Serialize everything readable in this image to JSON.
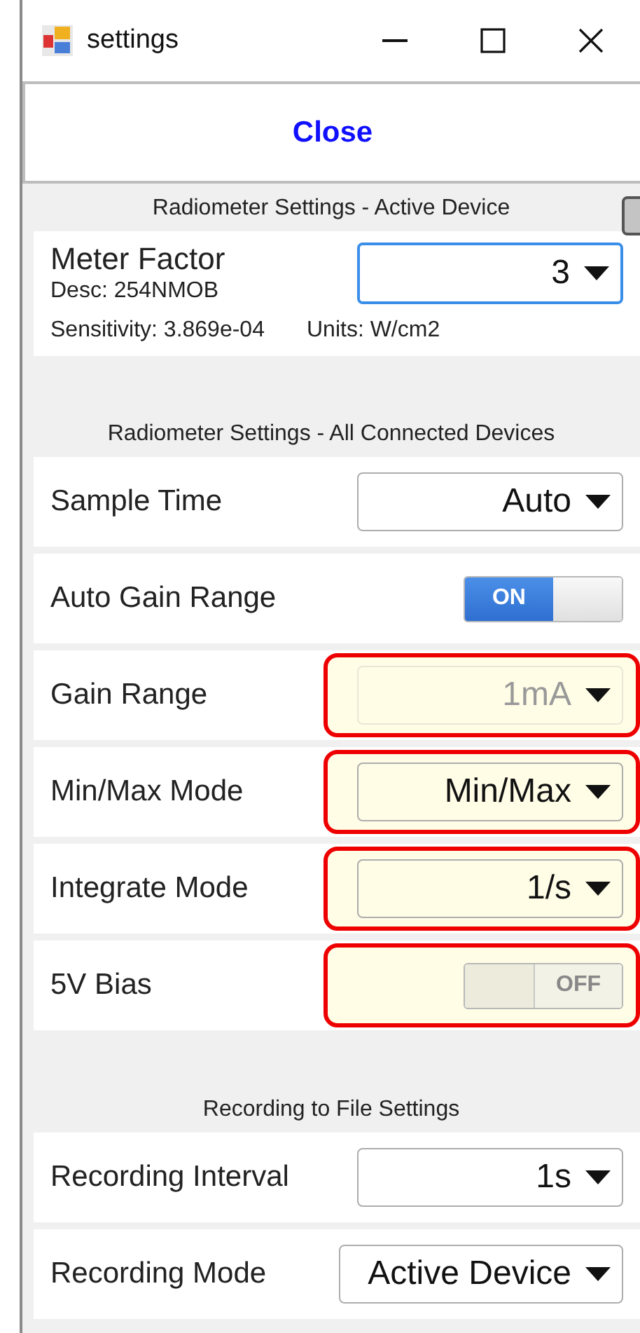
{
  "window": {
    "title": "settings"
  },
  "close_button": {
    "label": "Close"
  },
  "active_device": {
    "header": "Radiometer Settings - Active Device",
    "label": "Meter Factor",
    "desc": "Desc:  254NMOB",
    "sensitivity": "Sensitivity:  3.869e-04",
    "units": "Units: W/cm2",
    "dropdown": {
      "value": "3",
      "focused": true
    }
  },
  "sections": [
    {
      "header": "Radiometer Settings - All Connected Devices",
      "rows": [
        {
          "kind": "dropdown",
          "label": "Sample Time",
          "value": "Auto",
          "disabled": false,
          "highlighted": false
        },
        {
          "kind": "toggle",
          "label": "Auto Gain Range",
          "on": true,
          "toggle_label": "ON",
          "disabled": false,
          "highlighted": false
        },
        {
          "kind": "dropdown",
          "label": "Gain Range",
          "value": "1mA",
          "disabled": true,
          "highlighted": true
        },
        {
          "kind": "dropdown",
          "label": "Min/Max Mode",
          "value": "Min/Max",
          "disabled": false,
          "highlighted": true
        },
        {
          "kind": "dropdown",
          "label": "Integrate Mode",
          "value": "1/s",
          "disabled": false,
          "highlighted": true
        },
        {
          "kind": "toggle",
          "label": "5V Bias",
          "on": false,
          "toggle_label": "OFF",
          "disabled": true,
          "highlighted": true
        }
      ]
    },
    {
      "header": "Recording to File Settings",
      "rows": [
        {
          "kind": "dropdown",
          "label": "Recording Interval",
          "value": "1s",
          "disabled": false,
          "highlighted": false
        },
        {
          "kind": "dropdown",
          "label": "Recording Mode",
          "value": "Active Device",
          "disabled": false,
          "highlighted": false
        }
      ]
    }
  ]
}
